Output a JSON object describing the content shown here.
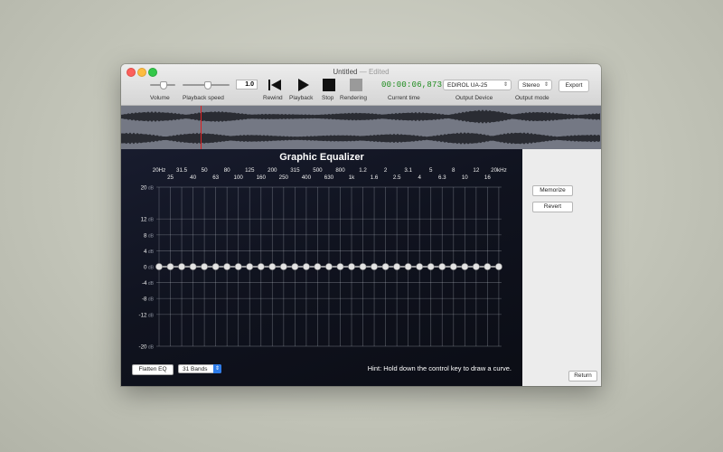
{
  "window": {
    "title": "Untitled",
    "edited": "— Edited"
  },
  "toolbar": {
    "volume_label": "Volume",
    "volume_level": 0.5,
    "speed_label": "Playback speed",
    "speed_value": "1.0",
    "rewind_label": "Rewind",
    "playback_label": "Playback",
    "stop_label": "Stop",
    "rendering_label": "Rendering",
    "time_value": "00:00:06,873",
    "time_label": "Current time",
    "output_device": "EDIROL UA-25",
    "output_device_label": "Output Device",
    "output_mode": "Stereo",
    "output_mode_label": "Output mode",
    "export_label": "Export"
  },
  "waveform": {
    "playhead_fraction": 0.166
  },
  "equalizer": {
    "title": "Graphic Equalizer",
    "freq_row1": [
      "20Hz",
      "31.5",
      "50",
      "80",
      "125",
      "200",
      "315",
      "500",
      "800",
      "1.2",
      "2",
      "3.1",
      "5",
      "8",
      "12",
      "20kHz"
    ],
    "freq_row2": [
      "25",
      "40",
      "63",
      "100",
      "160",
      "250",
      "400",
      "630",
      "1k",
      "1.6",
      "2.5",
      "4",
      "6.3",
      "10",
      "16"
    ],
    "db_labels": [
      {
        "value": 20,
        "label": "20 dB"
      },
      {
        "value": 12,
        "label": "12 dB"
      },
      {
        "value": 8,
        "label": "8 dB"
      },
      {
        "value": 4,
        "label": "4 dB"
      },
      {
        "value": 0,
        "label": "0 dB"
      },
      {
        "value": -4,
        "label": "-4 dB"
      },
      {
        "value": -8,
        "label": "-8 dB"
      },
      {
        "value": -12,
        "label": "-12 dB"
      },
      {
        "value": -20,
        "label": "-20 dB"
      }
    ],
    "db_range": [
      -20,
      20
    ],
    "band_count": 31,
    "gains": [
      0,
      0,
      0,
      0,
      0,
      0,
      0,
      0,
      0,
      0,
      0,
      0,
      0,
      0,
      0,
      0,
      0,
      0,
      0,
      0,
      0,
      0,
      0,
      0,
      0,
      0,
      0,
      0,
      0,
      0,
      0
    ],
    "flatten_label": "Flatten EQ",
    "bands_label": "31 Bands",
    "hint": "Hint: Hold down the control key to draw a curve."
  },
  "side_panel": {
    "memorize_label": "Memorize",
    "revert_label": "Revert",
    "return_label": "Return"
  },
  "colors": {
    "time_green": "#1a8a1a",
    "eq_background": "#10131f",
    "playhead": "#e02020",
    "waveform_bg": "#747884",
    "waveform_fill": "#2a2c33",
    "accent_blue": "#2d7be8"
  }
}
